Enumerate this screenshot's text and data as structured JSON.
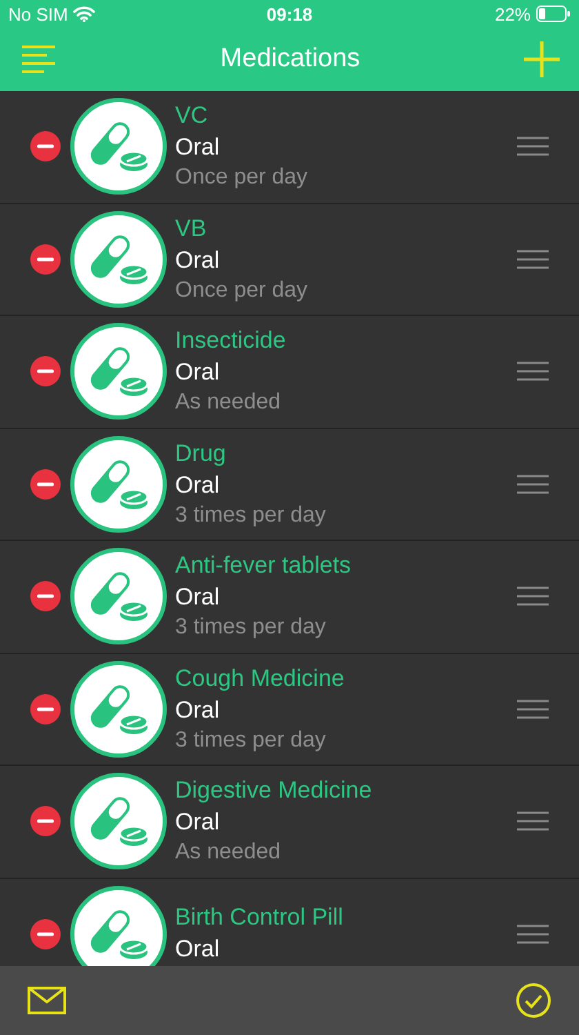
{
  "status_bar": {
    "carrier": "No SIM",
    "time": "09:18",
    "battery": "22%"
  },
  "nav": {
    "title": "Medications"
  },
  "medications": [
    {
      "name": "VC",
      "route": "Oral",
      "frequency": "Once per day"
    },
    {
      "name": "VB",
      "route": "Oral",
      "frequency": "Once per day"
    },
    {
      "name": "Insecticide",
      "route": "Oral",
      "frequency": "As needed"
    },
    {
      "name": "Drug",
      "route": "Oral",
      "frequency": "3 times per day"
    },
    {
      "name": "Anti-fever tablets",
      "route": "Oral",
      "frequency": "3 times per day"
    },
    {
      "name": "Cough Medicine",
      "route": "Oral",
      "frequency": "3 times per day"
    },
    {
      "name": "Digestive Medicine",
      "route": "Oral",
      "frequency": "As needed"
    },
    {
      "name": "Birth Control Pill",
      "route": "Oral"
    }
  ]
}
